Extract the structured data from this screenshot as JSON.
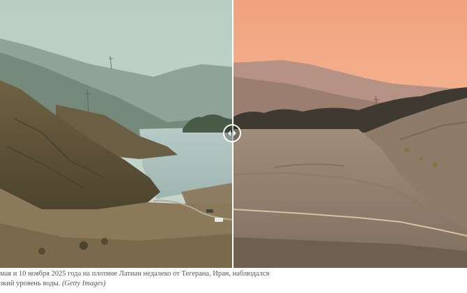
{
  "comparison": {
    "before_image_label": "Latian dam reservoir with water",
    "after_image_label": "Latian dam reservoir nearly dry",
    "handle_icon": "left-right-arrows-icon"
  },
  "caption": {
    "line1": "мая и 10 ноября 2025 года на плотине Латиан недалеко от Тегерана, Иран, наблюдался",
    "line2_text": "зкий уровень воды.",
    "credit": "(Getty Images)"
  },
  "colors": {
    "divider": "#ffffff",
    "caption_text": "#555555"
  }
}
